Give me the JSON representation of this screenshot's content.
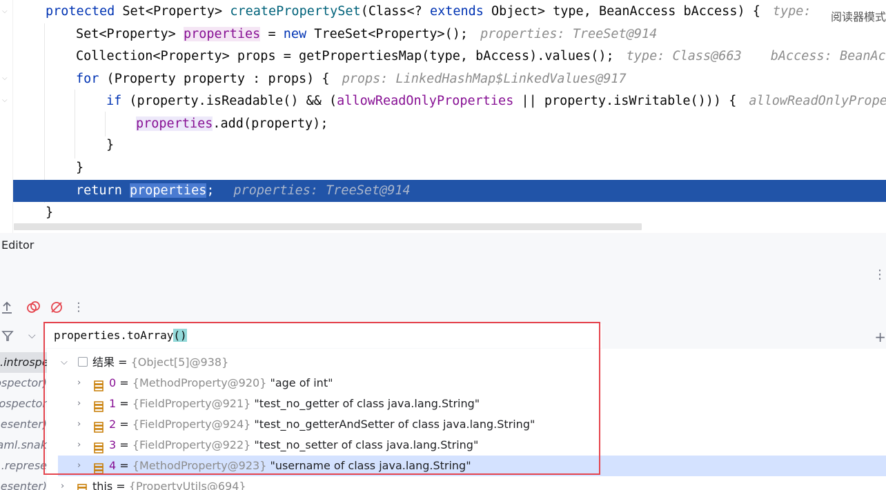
{
  "editor": {
    "lines": [
      {
        "kw": "protected",
        "rest1": " Set<Property> ",
        "fn": "createPropertySet",
        "rest2": "(Class<? ",
        "kw2": "extends",
        "rest3": " Object> type, BeanAccess bAccess) {",
        "hint": "type:"
      },
      {
        "a": "Set<Property> ",
        "var": "properties",
        "b": " = ",
        "kw": "new",
        "c": " TreeSet<Property>();",
        "hint": "properties: TreeSet@914"
      },
      {
        "a": "Collection<Property> props = getPropertiesMap(type, bAccess).values();",
        "hint": "type: Class@663",
        "hint2": "bAccess: BeanAcc"
      },
      {
        "kw": "for",
        "a": " (Property property : props) {",
        "hint": "props: LinkedHashMap$LinkedValues@917"
      },
      {
        "kw": "if",
        "a": " (property.isReadable() && (",
        "fld": "allowReadOnlyProperties",
        "b": " || property.isWritable())) {",
        "hint": "allowReadOnlyProper"
      },
      {
        "var": "properties",
        "a": ".add(property);"
      },
      {
        "a": "}"
      },
      {
        "a": "}"
      },
      {
        "kw": "return",
        "a": " ",
        "sel": "properties",
        "b": ";",
        "hint": "properties: TreeSet@914"
      },
      {
        "a": "}"
      }
    ],
    "reader_mode": "阅读器模式"
  },
  "panel": {
    "title": "Editor"
  },
  "evaluate": {
    "expression": "properties.toArray",
    "paren": "()"
  },
  "frames": [
    ".introspe",
    "ospector)",
    "ospector",
    "esenter)",
    "vaml.snak",
    ".represe",
    "esenter)"
  ],
  "vars": {
    "result": {
      "name": "结果",
      "eq": " = ",
      "ref": "{Object[5]@938}"
    },
    "items": [
      {
        "idx": "0",
        "ref": "{MethodProperty@920}",
        "val": "\"age of int\""
      },
      {
        "idx": "1",
        "ref": "{FieldProperty@921}",
        "val": "\"test_no_getter of class java.lang.String\""
      },
      {
        "idx": "2",
        "ref": "{FieldProperty@924}",
        "val": "\"test_no_getterAndSetter of class java.lang.String\""
      },
      {
        "idx": "3",
        "ref": "{FieldProperty@922}",
        "val": "\"test_no_setter of class java.lang.String\""
      },
      {
        "idx": "4",
        "ref": "{MethodProperty@923}",
        "val": "\"username of class java.lang.String\""
      }
    ],
    "this_row": {
      "name": "this",
      "ref": "{PropertyUtils@694}"
    }
  },
  "colors": {
    "selection": "#2154a8",
    "highlight_box": "#e5434c",
    "keyword": "#0033b3"
  }
}
